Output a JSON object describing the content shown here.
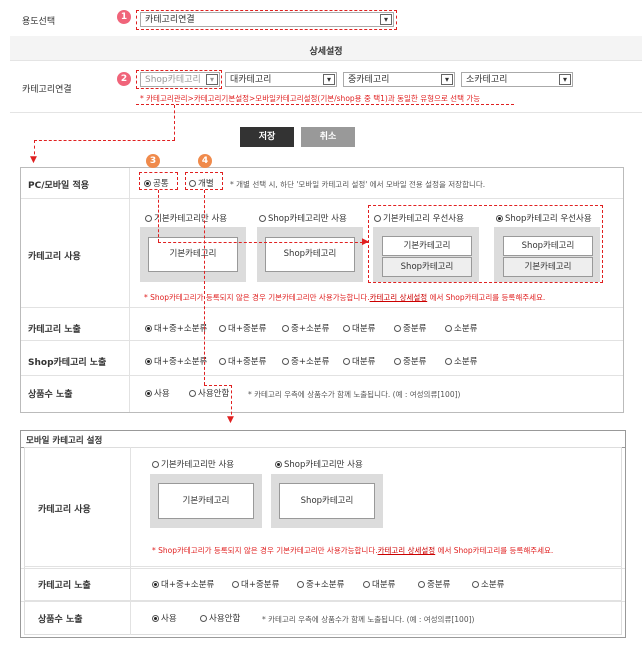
{
  "top": {
    "purpose_label": "용도선택",
    "purpose_value": "카테고리연결",
    "detail_header": "상세설정",
    "category_link_label": "카테고리연결",
    "shop_select": "Shop카테고리",
    "large_select": "대카테고리",
    "mid_select": "중카테고리",
    "small_select": "소카테고리",
    "note": "* 카테고리관리>카테고리기본설정>모바일카테고리설정(기본/shop용 중 택1)과 동일한 유형으로 선택 가능"
  },
  "badges": [
    "1",
    "2",
    "3",
    "4"
  ],
  "buttons": {
    "save": "저장",
    "cancel": "취소"
  },
  "pc_panel": {
    "pc_mobile_label": "PC/모바일 적용",
    "common": "공통",
    "individual": "개별",
    "individual_note": "* 개별 선택 시, 하단 '모바일 카테고리 설정' 에서 모바일 전용 설정을 저장합니다.",
    "category_use_label": "카테고리 사용",
    "opt_basic_only": "기본카테고리만 사용",
    "opt_shop_only": "Shop카테고리만 사용",
    "opt_basic_first": "기본카테고리 우선사용",
    "opt_shop_first": "Shop카테고리 우선사용",
    "box_basic": "기본카테고리",
    "box_shop": "Shop카테고리",
    "warn_pre": "* Shop카테고리가 등록되지 않은 경우 기본카테고리만 사용가능합니다.",
    "warn_link": "카테고리 상세설정",
    "warn_post": " 에서 Shop카테고리를 등록해주세요.",
    "category_expose_label": "카테고리 노출",
    "shop_expose_label": "Shop카테고리 노출",
    "count_label": "상품수 노출",
    "e1": "대+중+소분류",
    "e2": "대+중분류",
    "e3": "중+소분류",
    "e4": "대분류",
    "e5": "중분류",
    "e6": "소분류",
    "use": "사용",
    "no_use": "사용안함",
    "count_note": "* 카테고리 우측에 상품수가 함께 노출됩니다. (예 : 여성의류[100])"
  },
  "mobile_panel": {
    "title": "모바일 카테고리 설정",
    "category_use_label": "카테고리 사용",
    "opt_basic_only": "기본카테고리만 사용",
    "opt_shop_only": "Shop카테고리만 사용",
    "box_basic": "기본카테고리",
    "box_shop": "Shop카테고리",
    "warn_pre": "* Shop카테고리가 등록되지 않은 경우 기본카테고리만 사용가능합니다.",
    "warn_link": "카테고리 상세설정",
    "warn_post": " 에서 Shop카테고리를 등록해주세요.",
    "category_expose_label": "카테고리 노출",
    "count_label": "상품수 노출",
    "e1": "대+중+소분류",
    "e2": "대+중분류",
    "e3": "중+소분류",
    "e4": "대분류",
    "e5": "중분류",
    "e6": "소분류",
    "use": "사용",
    "no_use": "사용안함",
    "count_note": "* 카테고리 우측에 상품수가 함께 노출됩니다. (예 : 여성의류[100])"
  },
  "colors": {
    "accent_red": "#e02020",
    "badge_pink": "#f0647a",
    "badge_orange": "#f08a4b",
    "save_btn": "#333333",
    "cancel_btn": "#999999"
  }
}
